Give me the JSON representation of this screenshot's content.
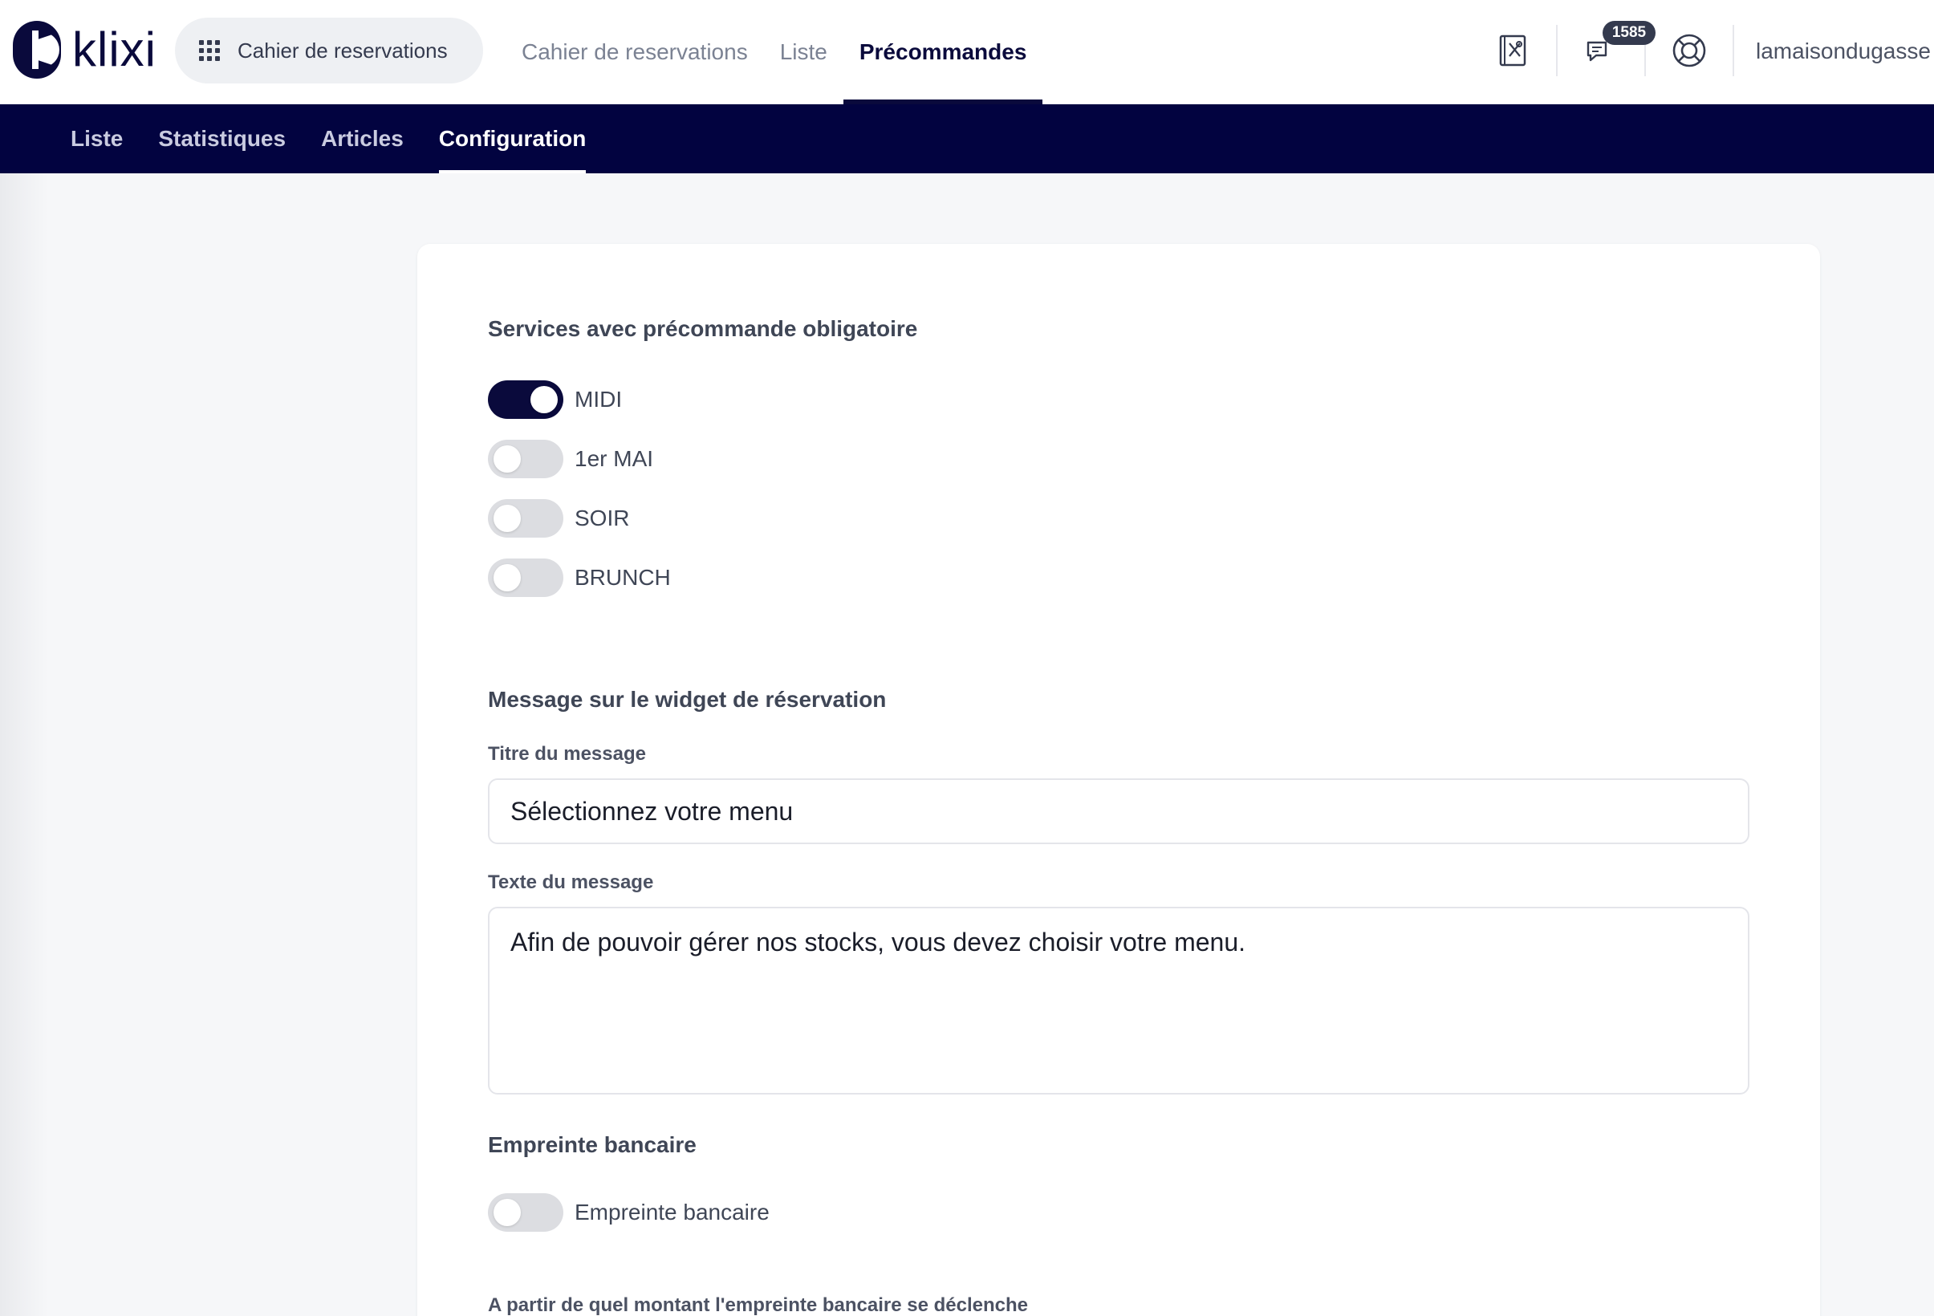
{
  "brand": {
    "logo_text": "klixi",
    "accent_color": "#020340"
  },
  "app_switcher": {
    "label": "Cahier de reservations",
    "icon": "grid-icon"
  },
  "top_nav": {
    "items": [
      {
        "label": "Cahier de reservations",
        "active": false
      },
      {
        "label": "Liste",
        "active": false
      },
      {
        "label": "Précommandes",
        "active": true
      }
    ]
  },
  "header_icons": {
    "menu_icon": "menu-card-icon",
    "messages_icon": "chat-bubbles-icon",
    "messages_badge": "1585",
    "help_icon": "lifebuoy-icon"
  },
  "user": {
    "name": "lamaisondugasse"
  },
  "sub_nav": {
    "items": [
      {
        "label": "Liste",
        "active": false
      },
      {
        "label": "Statistiques",
        "active": false
      },
      {
        "label": "Articles",
        "active": false
      },
      {
        "label": "Configuration",
        "active": true
      }
    ]
  },
  "config": {
    "services": {
      "title": "Services avec précommande obligatoire",
      "items": [
        {
          "label": "MIDI",
          "enabled": true
        },
        {
          "label": "1er MAI",
          "enabled": false
        },
        {
          "label": "SOIR",
          "enabled": false
        },
        {
          "label": "BRUNCH",
          "enabled": false
        }
      ]
    },
    "widget_message": {
      "title": "Message sur le widget de réservation",
      "title_field_label": "Titre du message",
      "title_field_value": "Sélectionnez votre menu",
      "text_field_label": "Texte du message",
      "text_field_value": "Afin de pouvoir gérer nos stocks, vous devez choisir votre menu."
    },
    "bank_imprint": {
      "title": "Empreinte bancaire",
      "toggle_label": "Empreinte bancaire",
      "enabled": false,
      "threshold_label": "A partir de quel montant l'empreinte bancaire se déclenche"
    }
  }
}
